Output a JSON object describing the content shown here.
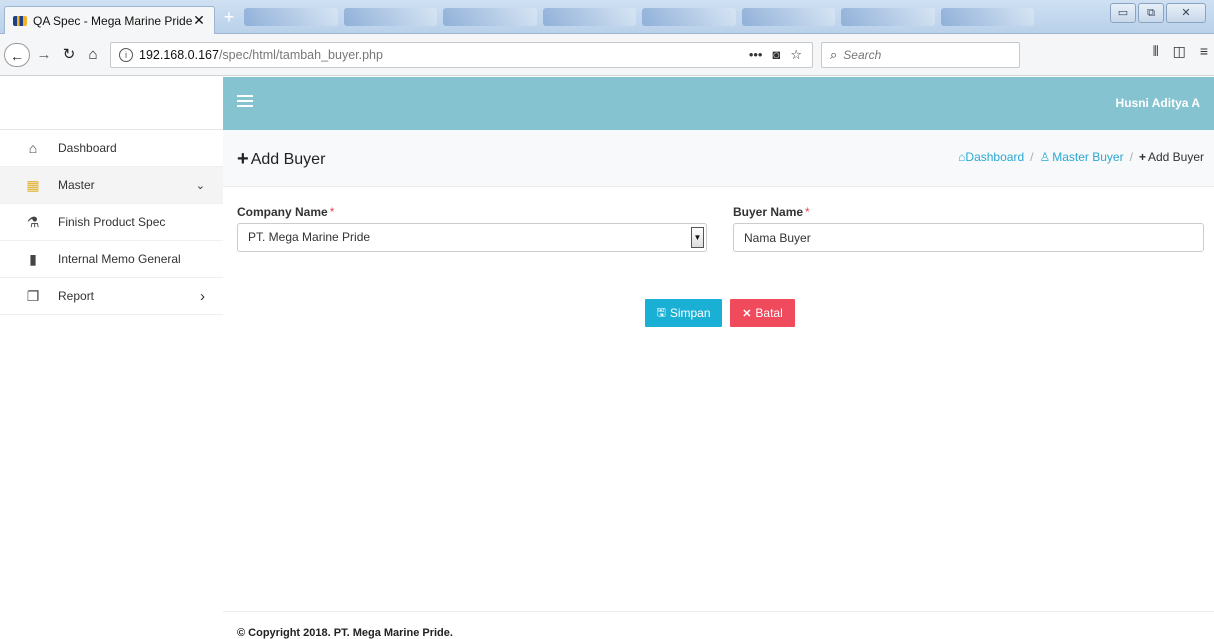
{
  "browser": {
    "tab_title": "QA Spec - Mega Marine Pride",
    "tab_close": "✕",
    "new_tab": "+",
    "url_host": "192.168.0.167",
    "url_path": "/spec/html/tambah_buyer.php",
    "search_placeholder": "Search",
    "window_controls": {
      "minimize": "▭",
      "restore": "⧉",
      "close": "✕"
    }
  },
  "header": {
    "user_name": "Husni Aditya A"
  },
  "sidebar": {
    "items": [
      {
        "label": "Dashboard",
        "icon": "home-icon"
      },
      {
        "label": "Master",
        "icon": "grid-icon",
        "chevron": "⌄"
      },
      {
        "label": "Finish Product Spec",
        "icon": "flask-icon"
      },
      {
        "label": "Internal Memo General",
        "icon": "file-icon"
      },
      {
        "label": "Report",
        "icon": "copy-file-icon",
        "chevron": "›"
      }
    ]
  },
  "page": {
    "title": "Add Buyer",
    "breadcrumb": {
      "home": "Dashboard",
      "parent": "Master Buyer",
      "current": "Add Buyer",
      "separator": "/"
    }
  },
  "form": {
    "company_label": "Company Name",
    "company_value": "PT. Mega Marine Pride",
    "buyer_label": "Buyer Name",
    "buyer_placeholder": "Nama Buyer",
    "required_mark": "*",
    "save_label": "Simpan",
    "cancel_label": "Batal"
  },
  "footer": {
    "copyright": "© Copyright 2018. PT. Mega Marine Pride."
  },
  "colors": {
    "header_bg": "#86c3d0",
    "link": "#2aa9d2",
    "save_btn": "#1ab0d6",
    "cancel_btn": "#ef4b5c",
    "required": "#e4494e"
  }
}
